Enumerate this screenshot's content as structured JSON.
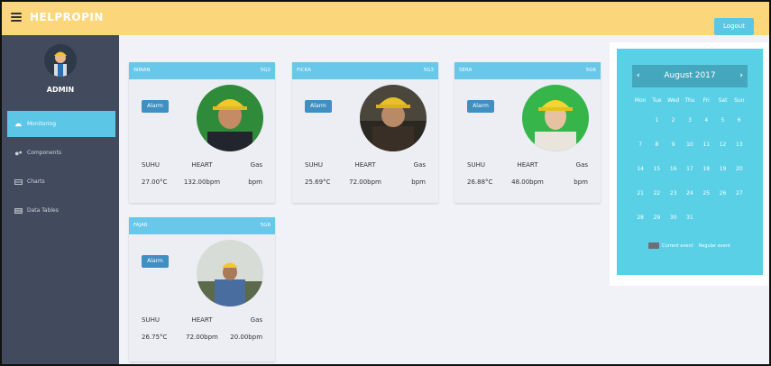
{
  "app": {
    "title": "HELPROPIN",
    "logout_label": "Logout"
  },
  "sidebar": {
    "user_name": "ADMIN",
    "items": [
      {
        "label": "Monitoring",
        "icon": "dashboard-icon",
        "active": true
      },
      {
        "label": "Components",
        "icon": "cogs-icon",
        "active": false
      },
      {
        "label": "Charts",
        "icon": "chart-icon",
        "active": false
      },
      {
        "label": "Data Tables",
        "icon": "table-icon",
        "active": false
      }
    ]
  },
  "workers": [
    {
      "name": "WIRAN",
      "id": "5G2",
      "alarm": "Alarm",
      "suhu_label": "SUHU",
      "heart_label": "HEART",
      "gas_label": "Gas",
      "suhu": "27.00°C",
      "heart": "132.00bpm",
      "gas": "bpm"
    },
    {
      "name": "FICKA",
      "id": "5G3",
      "alarm": "Alarm",
      "suhu_label": "SUHU",
      "heart_label": "HEART",
      "gas_label": "Gas",
      "suhu": "25.69°C",
      "heart": "72.00bpm",
      "gas": "bpm"
    },
    {
      "name": "SERA",
      "id": "5G6",
      "alarm": "Alarm",
      "suhu_label": "SUHU",
      "heart_label": "HEART",
      "gas_label": "Gas",
      "suhu": "26.88°C",
      "heart": "48.00bpm",
      "gas": "bpm"
    },
    {
      "name": "FAJAR",
      "id": "5G8",
      "alarm": "Alarm",
      "suhu_label": "SUHU",
      "heart_label": "HEART",
      "gas_label": "Gas",
      "suhu": "26.75°C",
      "heart": "72.00bpm",
      "gas": "20.00bpm"
    }
  ],
  "calendar": {
    "month": "August 2017",
    "days": [
      "Mon",
      "Tue",
      "Wed",
      "Thu",
      "Fri",
      "Sat",
      "Sun"
    ],
    "weeks": [
      [
        "",
        "1",
        "2",
        "3",
        "4",
        "5",
        "6"
      ],
      [
        "7",
        "8",
        "9",
        "10",
        "11",
        "12",
        "13"
      ],
      [
        "14",
        "15",
        "16",
        "17",
        "18",
        "19",
        "20"
      ],
      [
        "21",
        "22",
        "23",
        "24",
        "25",
        "26",
        "27"
      ],
      [
        "28",
        "29",
        "30",
        "31",
        "",
        "",
        ""
      ]
    ],
    "legend": [
      "Current event",
      "Regular event"
    ]
  },
  "colors": {
    "topbar": "#fcd67a",
    "sidebar": "#424a5d",
    "accent": "#5bc6e6",
    "card_header": "#69c7ea",
    "alarm": "#3f8fc2",
    "calendar": "#5ad0e6"
  }
}
